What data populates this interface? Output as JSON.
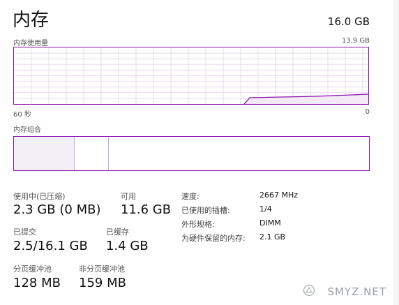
{
  "header": {
    "title": "内存",
    "total": "16.0 GB"
  },
  "usage_graph": {
    "label": "内存使用量",
    "max": "13.9 GB",
    "left_time": "60 秒",
    "right_time": "0",
    "color": "#8b12ae"
  },
  "composition": {
    "label": "内存组合"
  },
  "stats": {
    "in_use_label": "使用中(已压缩)",
    "in_use_value": "2.3 GB (0 MB)",
    "available_label": "可用",
    "available_value": "11.6 GB",
    "committed_label": "已提交",
    "committed_value": "2.5/16.1 GB",
    "cached_label": "已缓存",
    "cached_value": "1.4 GB",
    "paged_label": "分页缓冲池",
    "paged_value": "128 MB",
    "nonpaged_label": "非分页缓冲池",
    "nonpaged_value": "159 MB"
  },
  "specs": {
    "speed_label": "速度:",
    "speed_value": "2667 MHz",
    "slots_label": "已使用的插槽:",
    "slots_value": "1/4",
    "form_label": "外形规格:",
    "form_value": "DIMM",
    "reserved_label": "为硬件保留的内存:",
    "reserved_value": "2.1 GB"
  },
  "watermark": {
    "text": "SMYZ.NET"
  }
}
